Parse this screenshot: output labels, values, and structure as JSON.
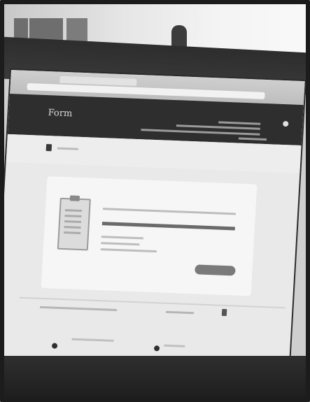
{
  "scene": {
    "logo_text": "Form"
  }
}
